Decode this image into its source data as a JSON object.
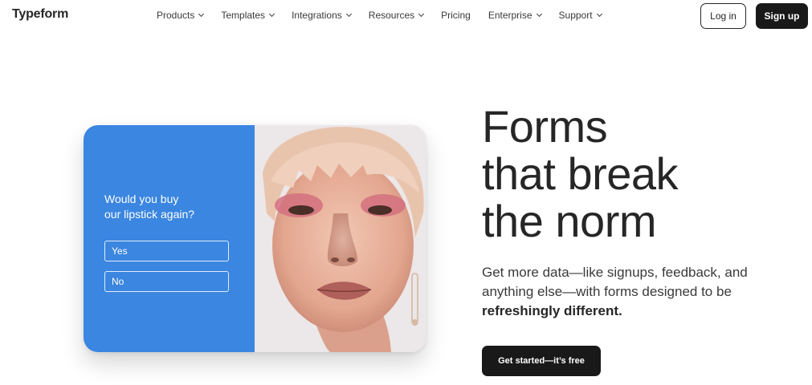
{
  "nav": {
    "logo": "Typeform",
    "menu": [
      {
        "label": "Products",
        "dropdown": true
      },
      {
        "label": "Templates",
        "dropdown": true
      },
      {
        "label": "Integrations",
        "dropdown": true
      },
      {
        "label": "Resources",
        "dropdown": true
      },
      {
        "label": "Pricing",
        "dropdown": false
      },
      {
        "label": "Enterprise",
        "dropdown": true
      },
      {
        "label": "Support",
        "dropdown": true
      }
    ],
    "login": "Log in",
    "signup": "Sign up"
  },
  "card": {
    "question_line1": "Would you buy",
    "question_line2": "our lipstick again?",
    "option_yes": "Yes",
    "option_no": "No",
    "accent_color": "#3a86e0",
    "image": "portrait-photo"
  },
  "hero": {
    "headline_line1": "Forms",
    "headline_line2": "that break",
    "headline_line3": "the norm",
    "subtext_main": "Get more data—like signups, feedback, and anything else—with forms designed to be ",
    "subtext_bold": "refreshingly different.",
    "cta": "Get started—it’s free"
  }
}
